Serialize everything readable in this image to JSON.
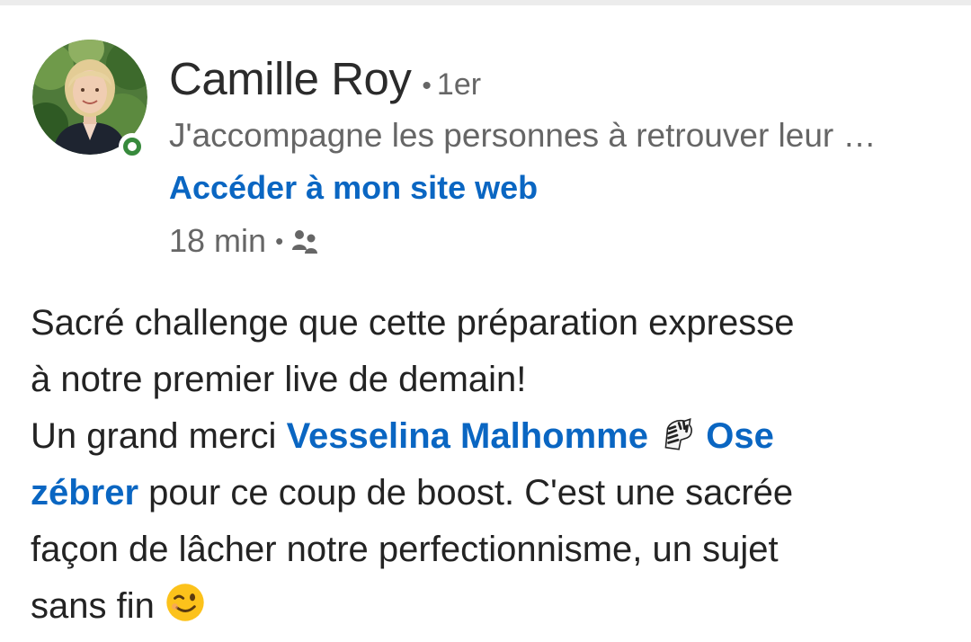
{
  "author": {
    "name": "Camille Roy",
    "degree": "1er",
    "headline": "J'accompagne les personnes à retrouver leur …",
    "website_label": "Accéder à mon site web",
    "online": true,
    "avatar_icon": "profile-photo"
  },
  "meta": {
    "time": "18 min",
    "separator": "•",
    "audience_icon": "connections-only-icon"
  },
  "post": {
    "line1": "Sacré challenge que cette préparation expresse",
    "line2": "à notre premier live de demain!",
    "thanks_prefix": "Un grand merci ",
    "mention_name": "Vesselina Malhomme",
    "mention_emoji": "zebra-emoji",
    "mention_suffix_1": "Ose",
    "mention_suffix_2": "zébrer",
    "after_mention": " pour ce coup de boost. C'est une sacrée",
    "line5": "façon de lâcher notre perfectionnisme, un sujet",
    "line6": "sans fin",
    "end_emoji": "wink-emoji"
  },
  "colors": {
    "link": "#0a66c2",
    "presence": "#378a3c",
    "text": "#232323",
    "secondary": "#666666"
  }
}
